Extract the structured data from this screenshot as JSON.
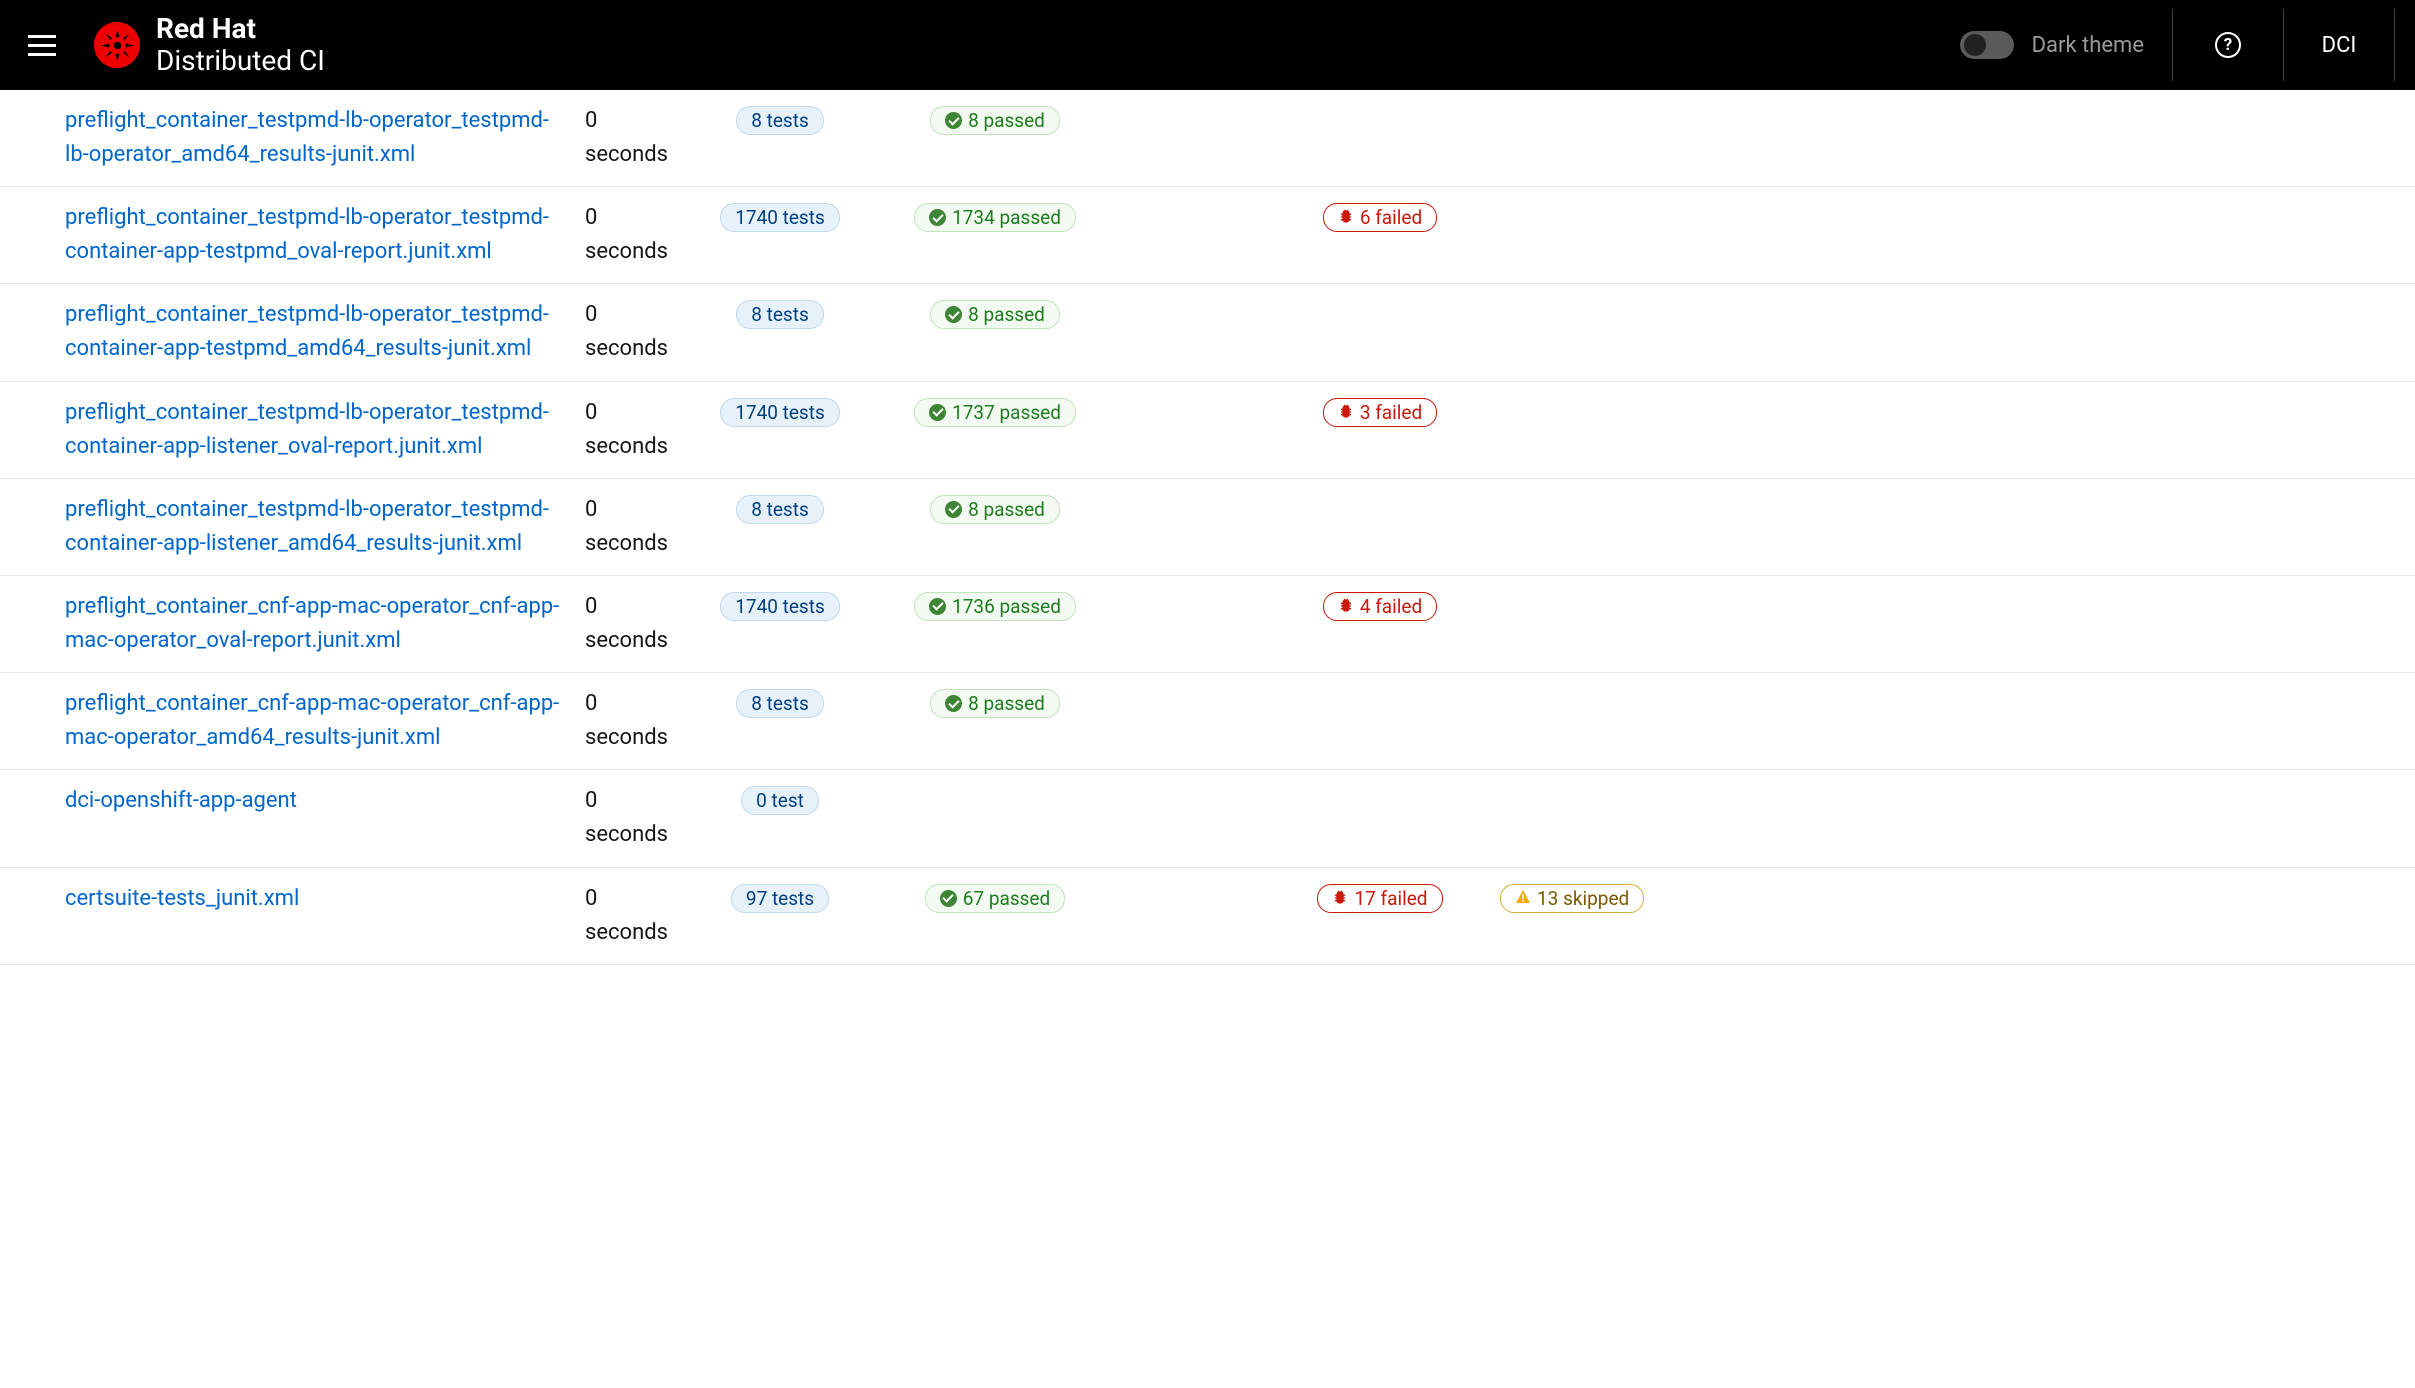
{
  "header": {
    "brand_line1": "Red Hat",
    "brand_line2": "Distributed CI",
    "theme_label": "Dark theme",
    "dci_label": "DCI"
  },
  "rows": [
    {
      "name": "preflight_container_testpmd-lb-operator_testpmd-lb-operator_amd64_results-junit.xml",
      "duration_value": "0",
      "duration_unit": "seconds",
      "tests": "8 tests",
      "passed": "8 passed",
      "failed": null,
      "skipped": null
    },
    {
      "name": "preflight_container_testpmd-lb-operator_testpmd-container-app-testpmd_oval-report.junit.xml",
      "duration_value": "0",
      "duration_unit": "seconds",
      "tests": "1740 tests",
      "passed": "1734 passed",
      "failed": "6 failed",
      "skipped": null
    },
    {
      "name": "preflight_container_testpmd-lb-operator_testpmd-container-app-testpmd_amd64_results-junit.xml",
      "duration_value": "0",
      "duration_unit": "seconds",
      "tests": "8 tests",
      "passed": "8 passed",
      "failed": null,
      "skipped": null
    },
    {
      "name": "preflight_container_testpmd-lb-operator_testpmd-container-app-listener_oval-report.junit.xml",
      "duration_value": "0",
      "duration_unit": "seconds",
      "tests": "1740 tests",
      "passed": "1737 passed",
      "failed": "3 failed",
      "skipped": null
    },
    {
      "name": "preflight_container_testpmd-lb-operator_testpmd-container-app-listener_amd64_results-junit.xml",
      "duration_value": "0",
      "duration_unit": "seconds",
      "tests": "8 tests",
      "passed": "8 passed",
      "failed": null,
      "skipped": null
    },
    {
      "name": "preflight_container_cnf-app-mac-operator_cnf-app-mac-operator_oval-report.junit.xml",
      "duration_value": "0",
      "duration_unit": "seconds",
      "tests": "1740 tests",
      "passed": "1736 passed",
      "failed": "4 failed",
      "skipped": null
    },
    {
      "name": "preflight_container_cnf-app-mac-operator_cnf-app-mac-operator_amd64_results-junit.xml",
      "duration_value": "0",
      "duration_unit": "seconds",
      "tests": "8 tests",
      "passed": "8 passed",
      "failed": null,
      "skipped": null
    },
    {
      "name": "dci-openshift-app-agent",
      "duration_value": "0",
      "duration_unit": "seconds",
      "tests": "0 test",
      "passed": null,
      "failed": null,
      "skipped": null
    },
    {
      "name": "certsuite-tests_junit.xml",
      "duration_value": "0",
      "duration_unit": "seconds",
      "tests": "97 tests",
      "passed": "67 passed",
      "failed": "17 failed",
      "skipped": "13 skipped"
    }
  ]
}
